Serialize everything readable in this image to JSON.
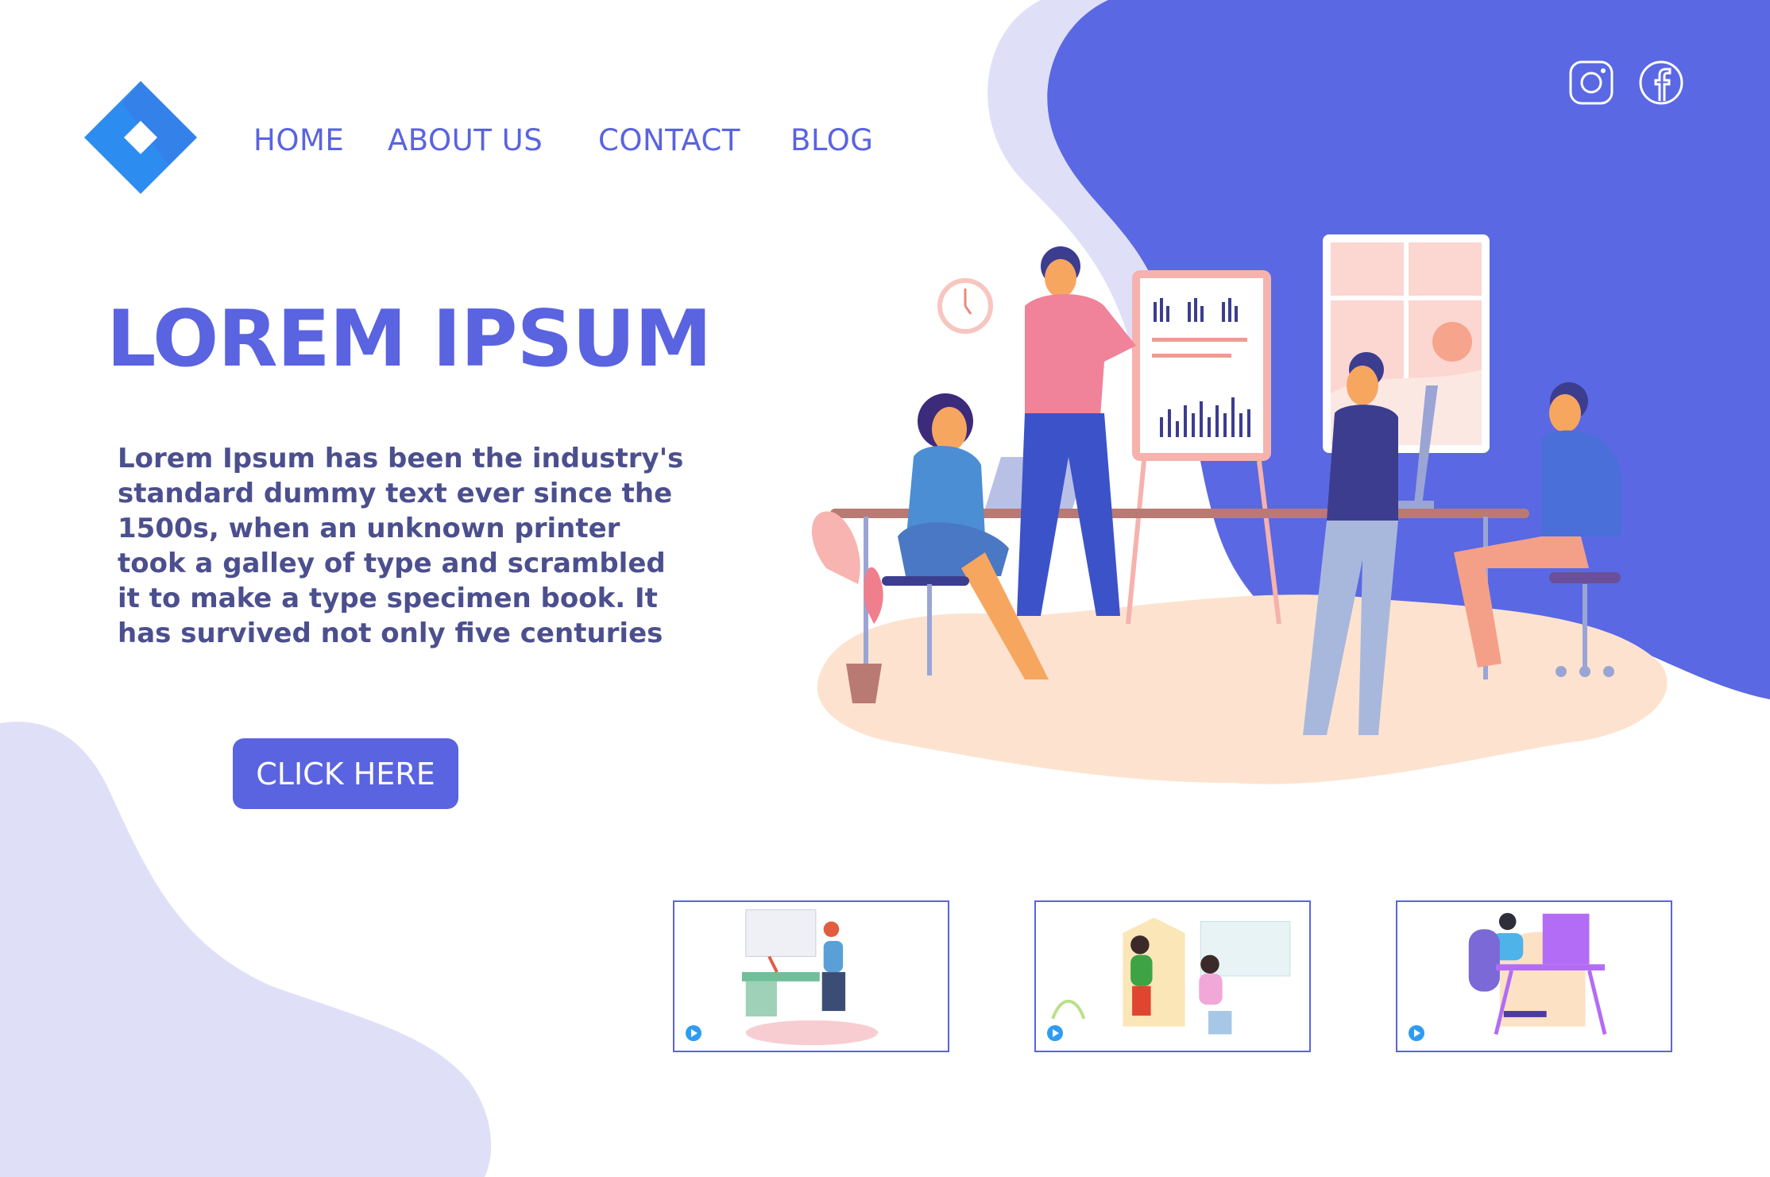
{
  "brand": {
    "logo_icon": "diamond-logo-icon",
    "accent": "#5a63e0",
    "logo_color": "#2d8cf0"
  },
  "nav": {
    "items": [
      {
        "label": "HOME"
      },
      {
        "label": "ABOUT US"
      },
      {
        "label": "CONTACT"
      },
      {
        "label": "BLOG"
      }
    ]
  },
  "social": {
    "instagram_icon": "instagram-icon",
    "facebook_icon": "facebook-icon"
  },
  "hero": {
    "title": "LOREM IPSUM",
    "text": "Lorem Ipsum has been the industry's standard dummy text ever since the 1500s, when an unknown printer took a galley of type and scrambled it to make a type specimen book. It has survived not only five centuries",
    "cta_label": "CLICK HERE",
    "illustration_icon": "office-team-illustration"
  },
  "thumbnails": [
    {
      "icon": "video-thumbnail-workspace-icon"
    },
    {
      "icon": "video-thumbnail-meeting-icon"
    },
    {
      "icon": "video-thumbnail-desk-icon"
    }
  ],
  "colors": {
    "blob_dark": "#5a68e3",
    "blob_light": "#dfe0f8",
    "text_body": "#4c4f8e"
  }
}
